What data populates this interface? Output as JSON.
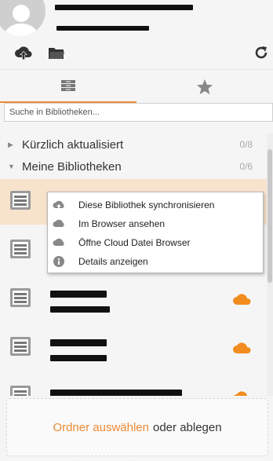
{
  "header": {
    "account_email": "",
    "account_server": "",
    "upload_icon": "cloud-upload-icon",
    "folder_icon": "folder-icon",
    "refresh_icon": "refresh-icon"
  },
  "tabs": [
    {
      "name": "libraries",
      "icon": "libraries-icon",
      "active": true
    },
    {
      "name": "starred",
      "icon": "star-icon",
      "active": false
    }
  ],
  "search": {
    "placeholder": "Suche in Bibliotheken..."
  },
  "sections": [
    {
      "label": "Kürzlich aktualisiert",
      "count": "0/8",
      "expanded": false
    },
    {
      "label": "Meine Bibliotheken",
      "count": "0/6",
      "expanded": true
    }
  ],
  "libraries": [
    {
      "name": "",
      "owner": "",
      "selected": true
    },
    {
      "name": "",
      "owner": "",
      "selected": false
    },
    {
      "name": "",
      "owner": "",
      "selected": false
    },
    {
      "name": "",
      "owner": "",
      "selected": false
    },
    {
      "name": "",
      "owner": "",
      "selected": false
    }
  ],
  "context_menu": [
    {
      "label": "Diese Bibliothek synchronisieren",
      "icon": "cloud-sync-icon"
    },
    {
      "label": "Im Browser ansehen",
      "icon": "cloud-icon"
    },
    {
      "label": "Öffne Cloud Datei Browser",
      "icon": "cloud-icon"
    },
    {
      "label": "Details anzeigen",
      "icon": "info-icon"
    }
  ],
  "dropzone": {
    "link_label": "Ordner auswählen",
    "rest_label": "oder ablegen"
  },
  "colors": {
    "accent": "#ef8a33",
    "selected_row": "#f7e2cc",
    "cloud": "#f28c1f"
  }
}
